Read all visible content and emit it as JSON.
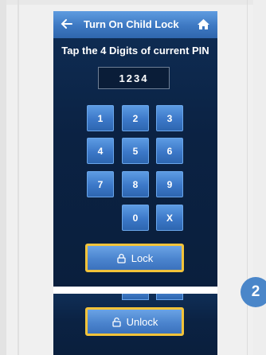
{
  "header": {
    "title": "Turn On Child Lock",
    "back_icon": "back-arrow-icon",
    "home_icon": "home-icon"
  },
  "instruction": "Tap the 4 Digits of current PIN",
  "pin_display": "1234",
  "keypad": {
    "keys": [
      "1",
      "2",
      "3",
      "4",
      "5",
      "6",
      "7",
      "8",
      "9",
      "0",
      "X"
    ]
  },
  "lock_button": {
    "label": "Lock",
    "icon": "padlock-icon"
  },
  "unlock_button": {
    "label": "Unlock",
    "icon": "unlocked-padlock-icon"
  },
  "step_badge": "2",
  "colors": {
    "panel_bg": "#0b2243",
    "header_blue": "#3d78c2",
    "key_blue": "#3c78c8",
    "highlight_border": "#f2c33a",
    "badge_blue": "#4a86c9"
  }
}
